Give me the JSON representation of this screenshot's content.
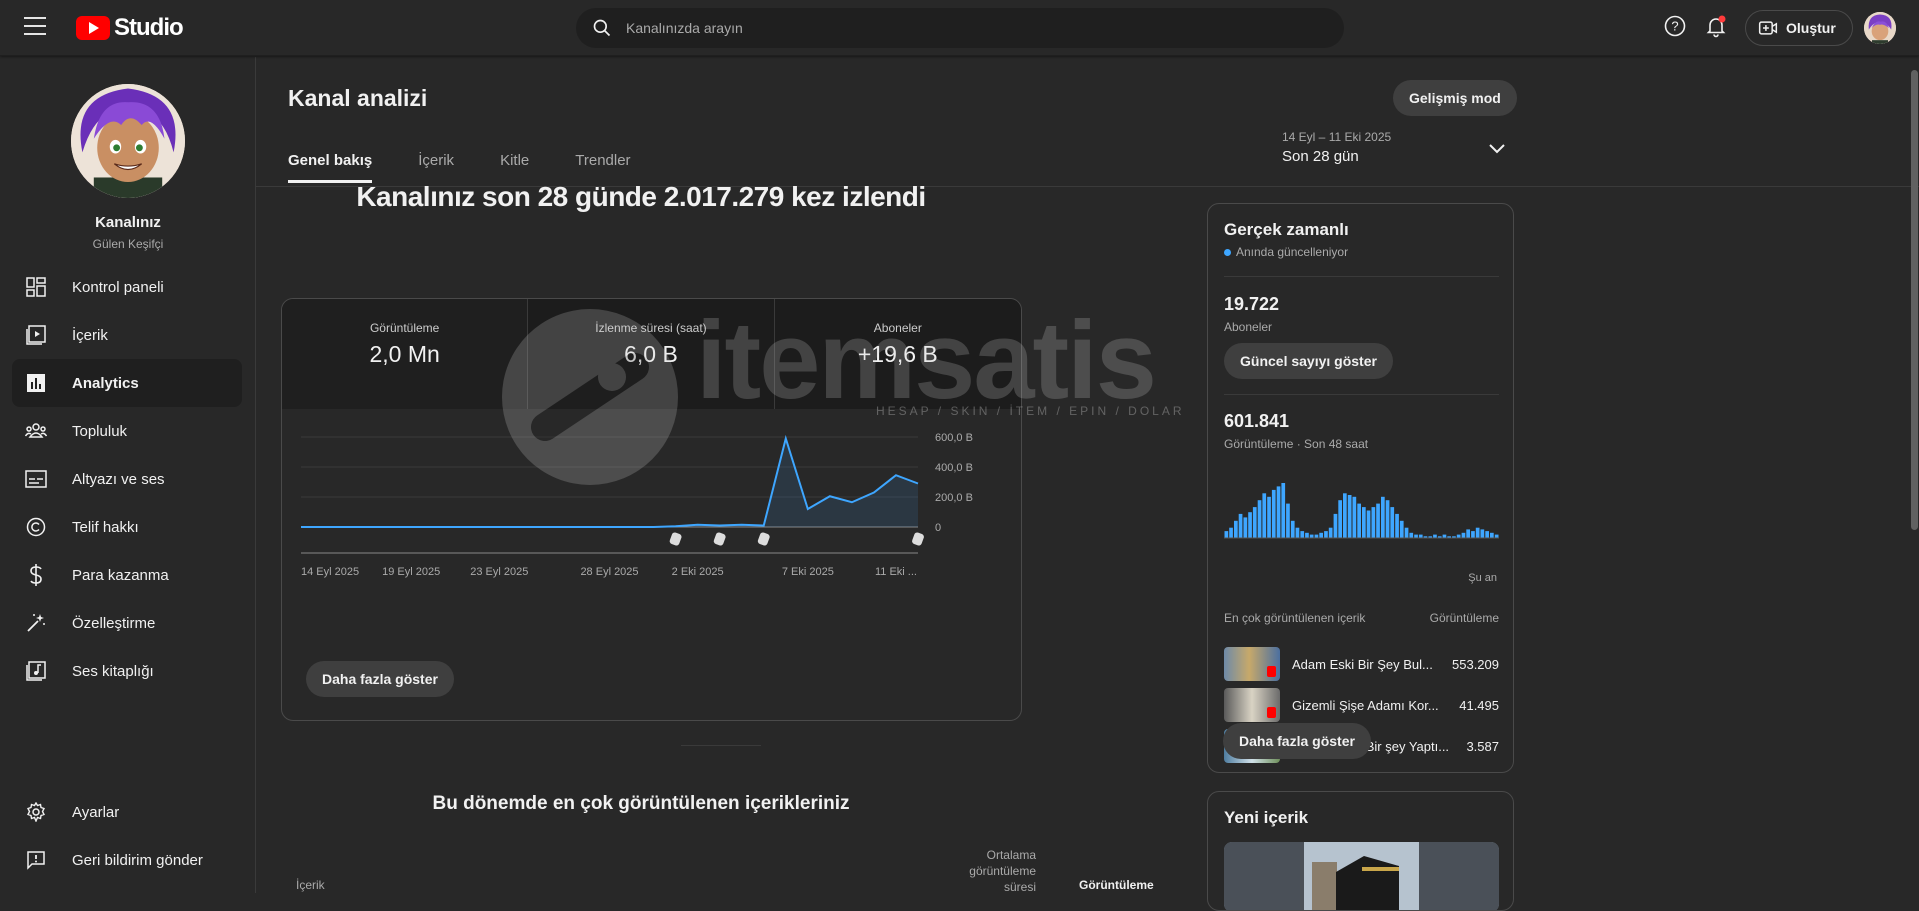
{
  "app": {
    "logo_text": "Studio"
  },
  "search": {
    "placeholder": "Kanalınızda arayın"
  },
  "topbar": {
    "create_label": "Oluştur",
    "help_icon": "help-icon",
    "bell_icon": "notifications-icon"
  },
  "channel": {
    "name": "Kanalınız",
    "subtitle": "Gülen Keşifçi"
  },
  "sidebar": {
    "items": [
      {
        "label": "Kontrol paneli",
        "icon": "dashboard-icon"
      },
      {
        "label": "İçerik",
        "icon": "content-icon"
      },
      {
        "label": "Analytics",
        "icon": "analytics-icon",
        "active": true
      },
      {
        "label": "Topluluk",
        "icon": "community-icon"
      },
      {
        "label": "Altyazı ve ses",
        "icon": "subtitles-icon"
      },
      {
        "label": "Telif hakkı",
        "icon": "copyright-icon"
      },
      {
        "label": "Para kazanma",
        "icon": "dollar-icon"
      },
      {
        "label": "Özelleştirme",
        "icon": "magic-wand-icon"
      },
      {
        "label": "Ses kitaplığı",
        "icon": "audio-library-icon"
      }
    ],
    "bottom": [
      {
        "label": "Ayarlar",
        "icon": "gear-icon"
      },
      {
        "label": "Geri bildirim gönder",
        "icon": "feedback-icon"
      }
    ]
  },
  "page": {
    "title": "Kanal analizi",
    "advanced_label": "Gelişmiş mod",
    "tabs": [
      "Genel bakış",
      "İçerik",
      "Kitle",
      "Trendler"
    ],
    "date_range_small": "14 Eyl – 11 Eki 2025",
    "date_range_label": "Son 28 gün",
    "headline": "Kanalınız son 28 günde 2.017.279 kez izlendi"
  },
  "metrics": [
    {
      "label": "Görüntüleme",
      "value": "2,0 Mn"
    },
    {
      "label": "İzlenme süresi (saat)",
      "value": "6,0 B"
    },
    {
      "label": "Aboneler",
      "value": "+19,6 B"
    }
  ],
  "chart_data": {
    "type": "area",
    "x": [
      "14 Eyl 2025",
      "15",
      "16",
      "17",
      "18",
      "19 Eyl 2025",
      "20",
      "21",
      "22",
      "23 Eyl 2025",
      "24",
      "25",
      "26",
      "27",
      "28 Eyl 2025",
      "29",
      "30",
      "1",
      "2 Eki 2025",
      "3",
      "4",
      "5",
      "6",
      "7 Eki 2025",
      "8",
      "9",
      "10",
      "11 Eki ..."
    ],
    "tick_labels": [
      "14 Eyl 2025",
      "19 Eyl 2025",
      "23 Eyl 2025",
      "28 Eyl 2025",
      "2 Eki 2025",
      "7 Eki 2025",
      "11 Eki ..."
    ],
    "series": [
      {
        "values": [
          0,
          0,
          0,
          0,
          0,
          0,
          0,
          0,
          0,
          0,
          0,
          0,
          0,
          0,
          0,
          0,
          0,
          5,
          15,
          10,
          15,
          10,
          590,
          120,
          205,
          165,
          230,
          345,
          290
        ]
      }
    ],
    "y_ticks": [
      "600,0 B",
      "400,0 B",
      "200,0 B",
      "0"
    ],
    "ylim": [
      0,
      600
    ],
    "color": "#3ea6ff"
  },
  "chart_more_label": "Daha fazla göster",
  "top_content": {
    "title": "Bu dönemde en çok görüntülenen içerikleriniz",
    "col_content": "İçerik",
    "col_avg": "Ortalama görüntüleme süresi",
    "col_views": "Görüntüleme"
  },
  "realtime": {
    "title": "Gerçek zamanlı",
    "subtitle": "Anında güncelleniyor",
    "subs_value": "19.722",
    "subs_label": "Aboneler",
    "show_count_label": "Güncel sayıyı göster",
    "views_value": "601.841",
    "views_label": "Görüntüleme · Son 48 saat",
    "now_label": "Şu an",
    "bars": [
      4,
      6,
      10,
      14,
      12,
      15,
      18,
      22,
      26,
      24,
      28,
      30,
      32,
      20,
      10,
      6,
      4,
      3,
      2,
      2,
      3,
      4,
      6,
      14,
      22,
      26,
      25,
      24,
      20,
      18,
      16,
      18,
      20,
      24,
      22,
      18,
      14,
      10,
      6,
      3,
      2,
      2,
      1,
      1,
      2,
      1,
      2,
      1,
      1,
      2,
      3,
      5,
      4,
      6,
      5,
      4,
      3,
      2
    ],
    "top_header_left": "En çok görüntülenen içerik",
    "top_header_right": "Görüntüleme",
    "top_items": [
      {
        "title": "Adam Eski Bir Şey Bul...",
        "views": "553.209"
      },
      {
        "title": "Gizemli Şişe Adamı Kor...",
        "views": "41.495"
      },
      {
        "title": "Balina İlginç Bir şey Yaptı...",
        "views": "3.587"
      }
    ],
    "more_label": "Daha fazla göster"
  },
  "new_content": {
    "title": "Yeni içerik"
  },
  "watermark": {
    "text": "itemsatis",
    "sub": "HESAP / SKIN / İTEM / EPIN / DOLAR"
  }
}
